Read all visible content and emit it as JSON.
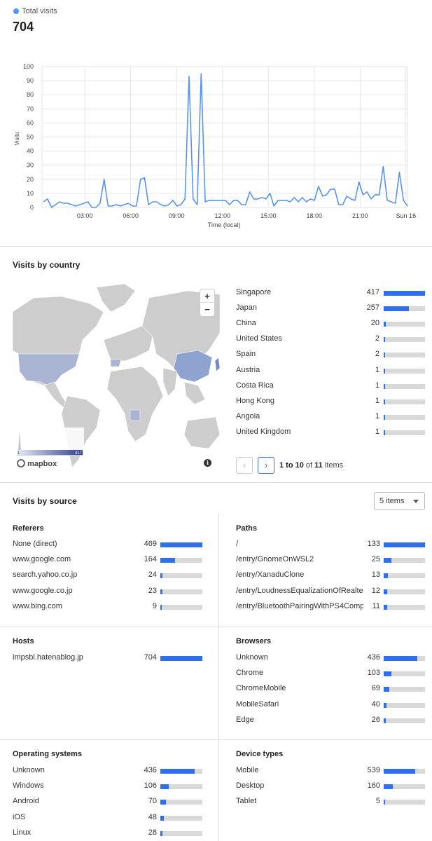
{
  "total_visits": {
    "label": "Total visits",
    "value": "704",
    "accent": "#5794f2"
  },
  "chart_data": {
    "type": "line",
    "title": "",
    "xlabel": "Time (local)",
    "ylabel": "Visits",
    "ylim": [
      0,
      100
    ],
    "yticks": [
      "0",
      "10",
      "20",
      "30",
      "40",
      "50",
      "60",
      "70",
      "80",
      "90",
      "100"
    ],
    "xticks": [
      "03:00",
      "06:00",
      "09:00",
      "12:00",
      "15:00",
      "18:00",
      "21:00",
      "Sun 16"
    ],
    "x_start_hour": 0.2,
    "x_end_hour": 24.1,
    "grid": true,
    "series": [
      {
        "name": "Total visits",
        "color": "#5794f2",
        "values": [
          4,
          6,
          0,
          2,
          4,
          3,
          3,
          2,
          1,
          2,
          3,
          4,
          0,
          0,
          3,
          20,
          1,
          1,
          2,
          1,
          2,
          3,
          1,
          1,
          20,
          21,
          2,
          4,
          4,
          2,
          1,
          2,
          5,
          1,
          2,
          6,
          93,
          6,
          2,
          95,
          4,
          5,
          5,
          5,
          5,
          5,
          2,
          5,
          5,
          2,
          2,
          11,
          6,
          6,
          7,
          6,
          10,
          1,
          5,
          5,
          5,
          4,
          7,
          4,
          7,
          4,
          6,
          5,
          15,
          8,
          9,
          13,
          13,
          2,
          2,
          8,
          6,
          5,
          18,
          9,
          11,
          6,
          9,
          9,
          29,
          5,
          4,
          3,
          25,
          5,
          1
        ]
      }
    ]
  },
  "country": {
    "title": "Visits by country",
    "max": 417,
    "legend_min": "1",
    "legend_max": "417",
    "map_attribution": "mapbox",
    "zoom_in": "+",
    "zoom_out": "−",
    "info_icon": "i",
    "items": [
      {
        "name": "Singapore",
        "value": 417
      },
      {
        "name": "Japan",
        "value": 257
      },
      {
        "name": "China",
        "value": 20
      },
      {
        "name": "United States",
        "value": 2
      },
      {
        "name": "Spain",
        "value": 2
      },
      {
        "name": "Austria",
        "value": 1
      },
      {
        "name": "Costa Rica",
        "value": 1
      },
      {
        "name": "Hong Kong",
        "value": 1
      },
      {
        "name": "Angola",
        "value": 1
      },
      {
        "name": "United Kingdom",
        "value": 1
      }
    ],
    "pager": {
      "prev": "‹",
      "next": "›",
      "range": "1 to 10",
      "of": "of",
      "total": "11",
      "suffix": "items"
    }
  },
  "source": {
    "title": "Visits by source",
    "dropdown": "5 items",
    "panels": {
      "referers": {
        "title": "Referers",
        "max": 469,
        "items": [
          {
            "name": "None (direct)",
            "value": 469
          },
          {
            "name": "www.google.com",
            "value": 164
          },
          {
            "name": "search.yahoo.co.jp",
            "value": 24
          },
          {
            "name": "www.google.co.jp",
            "value": 23
          },
          {
            "name": "www.bing.com",
            "value": 9
          }
        ]
      },
      "paths": {
        "title": "Paths",
        "max": 133,
        "items": [
          {
            "name": "/",
            "value": 133
          },
          {
            "name": "/entry/GnomeOnWSL2",
            "value": 25
          },
          {
            "name": "/entry/XanaduClone",
            "value": 13
          },
          {
            "name": "/entry/LoudnessEqualizationOfRealtek",
            "value": 12
          },
          {
            "name": "/entry/BluetoothPairingWithPS4Comp…",
            "value": 11
          }
        ]
      },
      "hosts": {
        "title": "Hosts",
        "max": 704,
        "items": [
          {
            "name": "impsbl.hatenablog.jp",
            "value": 704
          }
        ]
      },
      "browsers": {
        "title": "Browsers",
        "max": 539,
        "items": [
          {
            "name": "Unknown",
            "value": 436
          },
          {
            "name": "Chrome",
            "value": 103
          },
          {
            "name": "ChromeMobile",
            "value": 69
          },
          {
            "name": "MobileSafari",
            "value": 40
          },
          {
            "name": "Edge",
            "value": 26
          }
        ]
      },
      "os": {
        "title": "Operating systems",
        "max": 539,
        "items": [
          {
            "name": "Unknown",
            "value": 436
          },
          {
            "name": "Windows",
            "value": 106
          },
          {
            "name": "Android",
            "value": 70
          },
          {
            "name": "iOS",
            "value": 48
          },
          {
            "name": "Linux",
            "value": 28
          }
        ]
      },
      "devices": {
        "title": "Device types",
        "max": 704,
        "items": [
          {
            "name": "Mobile",
            "value": 539
          },
          {
            "name": "Desktop",
            "value": 160
          },
          {
            "name": "Tablet",
            "value": 5
          }
        ]
      }
    }
  },
  "colors": {
    "bar": "#2f6fed",
    "track": "#d9d9d9",
    "line": "#5794f2"
  }
}
